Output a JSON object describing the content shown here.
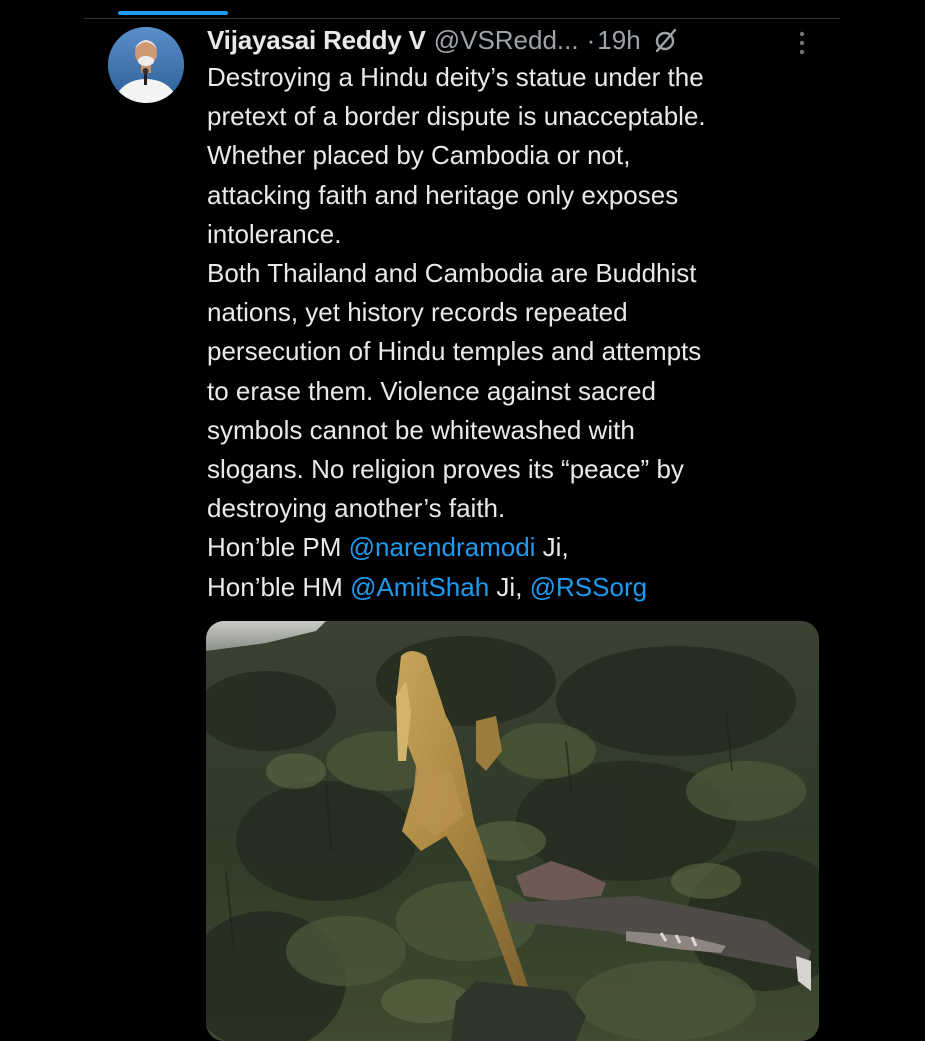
{
  "tweet": {
    "author": {
      "display_name": "Vijayasai Reddy V",
      "handle": "@VSRedd...",
      "separator": "·",
      "time": "19h"
    },
    "icons": {
      "grok": "grok-icon",
      "more": "more-vertical-icon"
    },
    "lines": [
      {
        "text": "Destroying a Hindu deity’s statue under the"
      },
      {
        "text": "pretext of a border dispute is unacceptable."
      },
      {
        "text": "Whether placed by Cambodia or not,"
      },
      {
        "text": "attacking faith and heritage only exposes"
      },
      {
        "text": "intolerance."
      },
      {
        "text": "Both Thailand and Cambodia are Buddhist"
      },
      {
        "text": "nations, yet history records repeated"
      },
      {
        "text": "persecution of Hindu temples and attempts"
      },
      {
        "text": "to erase them. Violence against sacred"
      },
      {
        "text": "symbols cannot be whitewashed with"
      },
      {
        "text": "slogans. No religion proves its “peace” by"
      },
      {
        "text": "destroying another’s faith."
      }
    ],
    "pm_line": {
      "prefix": "Hon’ble PM ",
      "mention": "@narendramodi",
      "suffix": " Ji,"
    },
    "hm_line": {
      "prefix": "Hon’ble HM ",
      "mention1": "@AmitShah",
      "middle": " Ji, ",
      "mention2": "@RSSorg"
    },
    "colors": {
      "background": "#000000",
      "text": "#e7e9ea",
      "secondary": "#9ea3a8",
      "link": "#1d9bf0"
    }
  }
}
